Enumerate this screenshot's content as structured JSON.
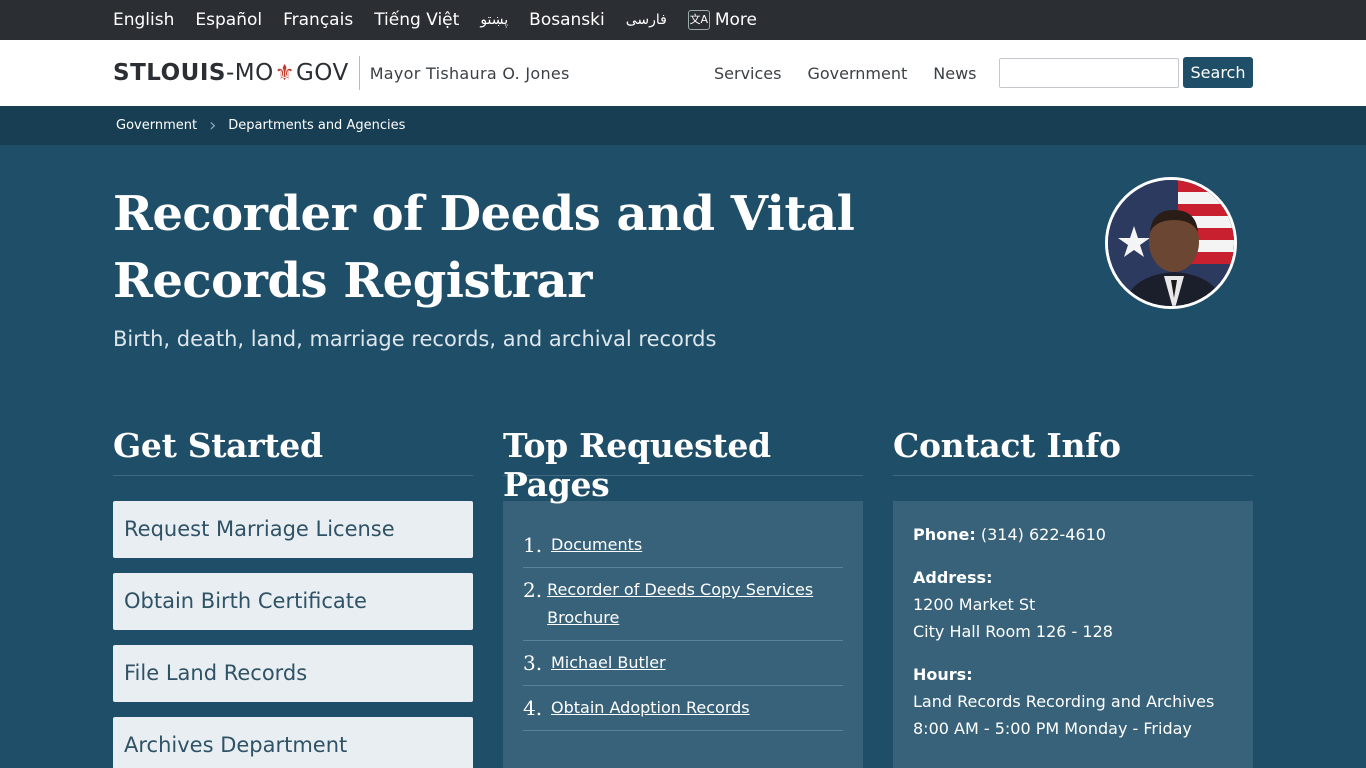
{
  "languages": [
    "English",
    "Español",
    "Français",
    "Tiếng Việt",
    "پښتو",
    "Bosanski",
    "فارسی"
  ],
  "more_label": "More",
  "logo": {
    "strong": "STLOUIS",
    "dash": "-MO",
    "fleur": "⚜",
    "gov": "GOV"
  },
  "mayor": "Mayor Tishaura O. Jones",
  "nav": [
    "Services",
    "Government",
    "News"
  ],
  "search": {
    "placeholder": "",
    "button": "Search"
  },
  "breadcrumb": [
    "Government",
    "Departments and Agencies"
  ],
  "hero": {
    "title": "Recorder of Deeds and Vital Records Registrar",
    "subtitle": "Birth, death, land, marriage records, and archival records"
  },
  "get_started": {
    "heading": "Get Started",
    "buttons": [
      "Request Marriage License",
      "Obtain Birth Certificate",
      "File Land Records",
      "Archives Department"
    ]
  },
  "top_pages": {
    "heading": "Top Requested Pages",
    "items": [
      {
        "num": "1.",
        "label": "Documents"
      },
      {
        "num": "2.",
        "label": "Recorder of Deeds Copy Services Brochure"
      },
      {
        "num": "3.",
        "label": "Michael Butler"
      },
      {
        "num": "4.",
        "label": "Obtain Adoption Records"
      }
    ]
  },
  "contact": {
    "heading": "Contact Info",
    "phone_label": "Phone:",
    "phone": "(314) 622-4610",
    "address_label": "Address:",
    "address_line1": "1200 Market St",
    "address_line2": "City Hall Room 126 - 128",
    "hours_label": "Hours:",
    "hours_line1": "Land Records Recording and Archives",
    "hours_line2": "8:00 AM - 5:00 PM Monday - Friday"
  },
  "colors": {
    "topbar": "#2b2f33",
    "brand": "#1f4f68",
    "breadcrumb": "#183e53",
    "panel": "#376279"
  }
}
